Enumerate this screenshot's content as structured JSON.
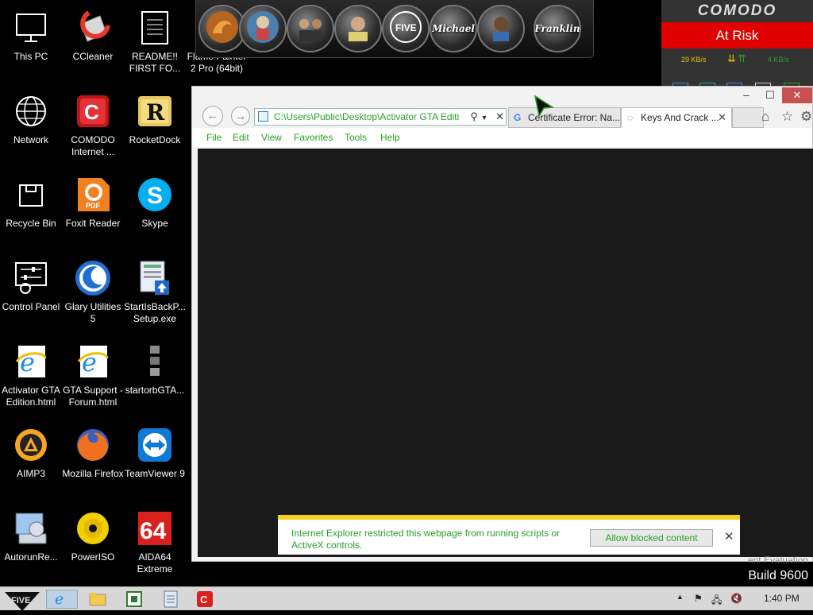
{
  "desktop": {
    "icons": [
      {
        "label": "This PC"
      },
      {
        "label": "CCleaner"
      },
      {
        "label": "README!! FIRST FO..."
      },
      {
        "label": "Flame Painter 2 Pro (64bit)"
      },
      {
        "label": "Network"
      },
      {
        "label": "COMODO Internet ..."
      },
      {
        "label": "RocketDock"
      },
      {
        "label": "Recycle Bin"
      },
      {
        "label": "Foxit Reader"
      },
      {
        "label": "Skype"
      },
      {
        "label": "Control Panel"
      },
      {
        "label": "Glary Utilities 5"
      },
      {
        "label": "StartIsBackP... Setup.exe"
      },
      {
        "label": "Activator GTA Edition.html"
      },
      {
        "label": "GTA Support - Forum.html"
      },
      {
        "label": "startorbGTA..."
      },
      {
        "label": "AIMP3"
      },
      {
        "label": "Mozilla Firefox"
      },
      {
        "label": "TeamViewer 9"
      },
      {
        "label": "AutorunRe..."
      },
      {
        "label": "PowerISO"
      },
      {
        "label": "AIDA64 Extreme"
      }
    ]
  },
  "dock": {
    "items": [
      {
        "icon": "flame-painter-icon",
        "text": ""
      },
      {
        "icon": "gta-lucia-icon",
        "text": ""
      },
      {
        "icon": "gta-group-icon",
        "text": ""
      },
      {
        "icon": "gta-trevor-icon",
        "text": ""
      },
      {
        "icon": "gta-five-logo-icon",
        "text": ""
      },
      {
        "icon": "gta-michael-icon",
        "text": "Michael"
      },
      {
        "icon": "gta-lamar-icon",
        "text": ""
      },
      {
        "icon": "gta-franklin-icon",
        "text": "Franklin"
      }
    ]
  },
  "comodo": {
    "brand": "COMODO",
    "status": "At Risk",
    "download": "29 KB/s",
    "upload": "4 KB/s"
  },
  "browser": {
    "address": "C:\\Users\\Public\\Desktop\\Activator GTA Editi",
    "tabs": [
      {
        "title": "Certificate Error: Na...",
        "active": false
      },
      {
        "title": "Keys And Crack ...",
        "active": true
      }
    ],
    "menu": [
      "File",
      "Edit",
      "View",
      "Favorites",
      "Tools",
      "Help"
    ],
    "infobar": {
      "message": "Internet Explorer restricted this webpage from running scripts or ActiveX controls.",
      "button": "Allow blocked content"
    }
  },
  "watermark": {
    "edition": "ent Evaluation",
    "build": "Build 9600"
  },
  "taskbar": {
    "time": "1:40 PM"
  },
  "colors": {
    "accent_green": "#2aa02a",
    "comodo_red": "#e00000",
    "infobar_yellow": "#f7d117"
  }
}
